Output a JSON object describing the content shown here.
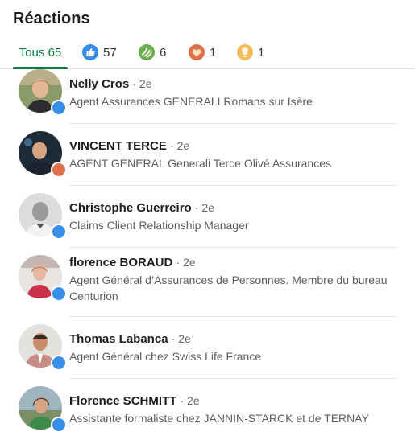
{
  "title": "Réactions",
  "tabs": [
    {
      "label": "Tous 65",
      "icon": ""
    },
    {
      "label": "57",
      "icon": "like-icon"
    },
    {
      "label": "6",
      "icon": "celebrate-icon"
    },
    {
      "label": "1",
      "icon": "love-icon"
    },
    {
      "label": "1",
      "icon": "insightful-icon"
    }
  ],
  "colors": {
    "accent": "#0a7a3e",
    "like": "#378fe9",
    "love": "#df704d",
    "celebrate": "#44712e",
    "insight": "#f5bb5c"
  },
  "people": [
    {
      "name": "Nelly Cros",
      "degree": "· 2e",
      "headline": "Agent Assurances GENERALI Romans sur Isère",
      "reaction": "like"
    },
    {
      "name": "VINCENT TERCE",
      "degree": "· 2e",
      "headline": "AGENT GENERAL Generali Terce Olivé Assurances",
      "reaction": "love"
    },
    {
      "name": "Christophe Guerreiro",
      "degree": "· 2e",
      "headline": "Claims Client Relationship Manager",
      "reaction": "like"
    },
    {
      "name": "florence BORAUD",
      "degree": "· 2e",
      "headline": "Agent Général d’Assurances de Personnes. Membre du bureau Centurion",
      "reaction": "like"
    },
    {
      "name": "Thomas Labanca",
      "degree": "· 2e",
      "headline": "Agent Général chez Swiss Life France",
      "reaction": "like"
    },
    {
      "name": "Florence SCHMITT",
      "degree": "· 2e",
      "headline": "Assistante formaliste chez JANNIN-STARCK et de TERNAY",
      "reaction": "like"
    }
  ]
}
